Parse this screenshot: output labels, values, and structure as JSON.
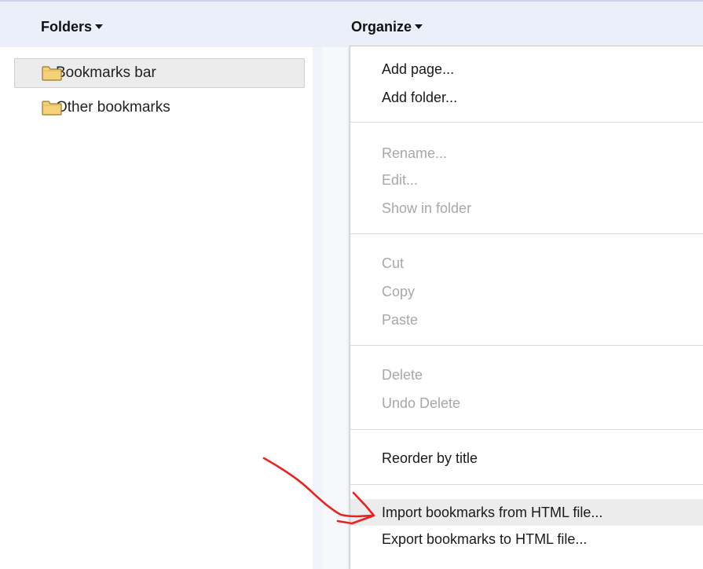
{
  "header": {
    "folders_label": "Folders",
    "organize_label": "Organize"
  },
  "folder_tree": {
    "items": [
      {
        "label": "Bookmarks bar",
        "icon": "folder-icon",
        "selected": true
      },
      {
        "label": "Other bookmarks",
        "icon": "folder-icon",
        "selected": false
      }
    ]
  },
  "organize_menu": {
    "groups": [
      [
        {
          "label": "Add page...",
          "enabled": true
        },
        {
          "label": "Add folder...",
          "enabled": true
        }
      ],
      [
        {
          "label": "Rename...",
          "enabled": false
        },
        {
          "label": "Edit...",
          "enabled": false
        },
        {
          "label": "Show in folder",
          "enabled": false
        }
      ],
      [
        {
          "label": "Cut",
          "enabled": false
        },
        {
          "label": "Copy",
          "enabled": false
        },
        {
          "label": "Paste",
          "enabled": false
        }
      ],
      [
        {
          "label": "Delete",
          "enabled": false
        },
        {
          "label": "Undo Delete",
          "enabled": false
        }
      ],
      [
        {
          "label": "Reorder by title",
          "enabled": true
        }
      ],
      [
        {
          "label": "Import bookmarks from HTML file...",
          "enabled": true,
          "highlighted": true
        },
        {
          "label": "Export bookmarks to HTML file...",
          "enabled": true
        }
      ]
    ]
  },
  "colors": {
    "header_band": "#ebeff9",
    "folder_fill": "#f5d27a",
    "folder_stroke": "#9a7a2c",
    "disabled_text": "#a8a8a8",
    "annotation_arrow": "#e8231f"
  }
}
